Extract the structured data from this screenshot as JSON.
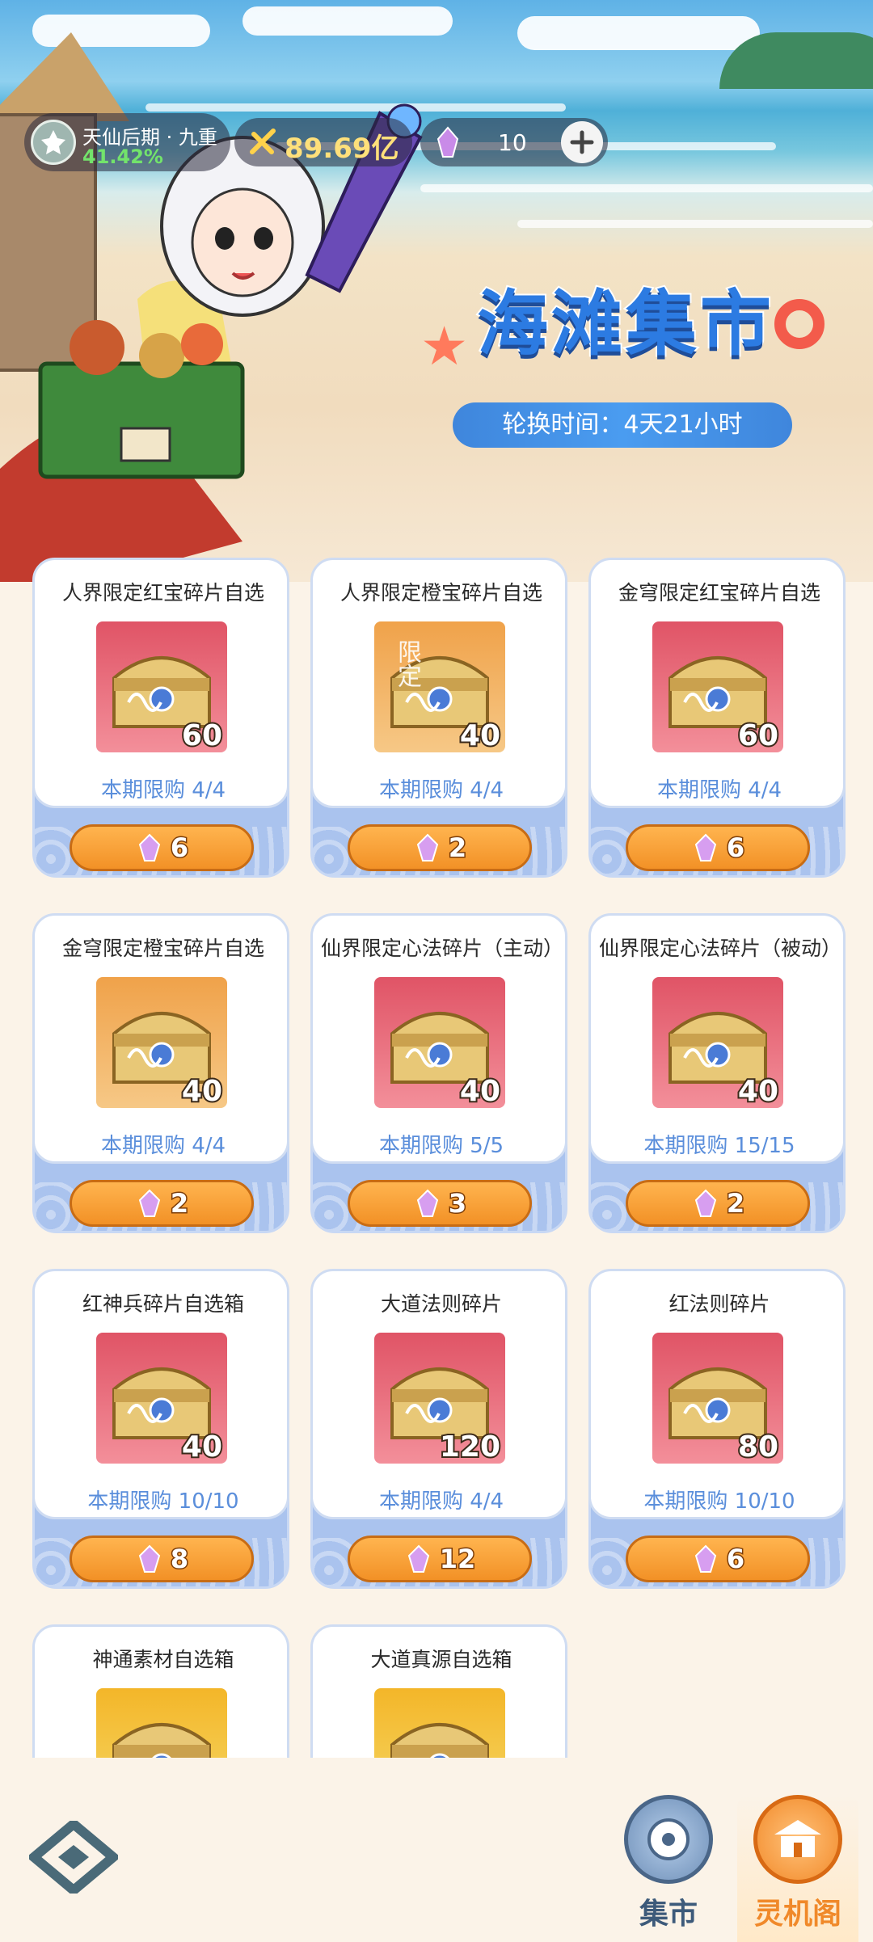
{
  "hud": {
    "realm": "天仙后期 · 九重",
    "realm_progress": "41.42%",
    "money": "89.69亿",
    "crystals": "10"
  },
  "banner": {
    "title": "海滩集市",
    "rotation_label": "轮换时间：",
    "rotation_value": "4天21小时"
  },
  "items": [
    {
      "name": "人界限定红宝碎片自选",
      "qty": "60",
      "limit": "本期限购 4/4",
      "price": "6",
      "color": "red",
      "tag": ""
    },
    {
      "name": "人界限定橙宝碎片自选",
      "qty": "40",
      "limit": "本期限购 4/4",
      "price": "2",
      "color": "orange",
      "tag": "限定"
    },
    {
      "name": "金穹限定红宝碎片自选",
      "qty": "60",
      "limit": "本期限购 4/4",
      "price": "6",
      "color": "red",
      "tag": ""
    },
    {
      "name": "金穹限定橙宝碎片自选",
      "qty": "40",
      "limit": "本期限购 4/4",
      "price": "2",
      "color": "orange",
      "tag": ""
    },
    {
      "name": "仙界限定心法碎片（主动）",
      "qty": "40",
      "limit": "本期限购 5/5",
      "price": "3",
      "color": "red",
      "tag": ""
    },
    {
      "name": "仙界限定心法碎片（被动）",
      "qty": "40",
      "limit": "本期限购 15/15",
      "price": "2",
      "color": "red",
      "tag": ""
    },
    {
      "name": "红神兵碎片自选箱",
      "qty": "40",
      "limit": "本期限购 10/10",
      "price": "8",
      "color": "red",
      "tag": ""
    },
    {
      "name": "大道法则碎片",
      "qty": "120",
      "limit": "本期限购 4/4",
      "price": "12",
      "color": "red",
      "tag": ""
    },
    {
      "name": "红法则碎片",
      "qty": "80",
      "limit": "本期限购 10/10",
      "price": "6",
      "color": "red",
      "tag": ""
    },
    {
      "name": "神通素材自选箱",
      "qty": "",
      "limit": "",
      "price": "",
      "color": "gold",
      "tag": ""
    },
    {
      "name": "大道真源自选箱",
      "qty": "",
      "limit": "",
      "price": "",
      "color": "gold",
      "tag": ""
    }
  ],
  "nav": {
    "market": "集市",
    "pavilion": "灵机阁"
  },
  "colors": {
    "accent_orange": "#f29126",
    "limit_text": "#5a8edb",
    "title_blue": "#2c7be2",
    "progress_green": "#73e36b"
  },
  "icons": [
    "realm-emblem-icon",
    "money-icon",
    "crystal-icon",
    "plus-icon",
    "treasure-chest-icon",
    "dao-scroll-icon",
    "question-gem-icon",
    "back-logo-icon",
    "market-icon",
    "pavilion-icon"
  ]
}
